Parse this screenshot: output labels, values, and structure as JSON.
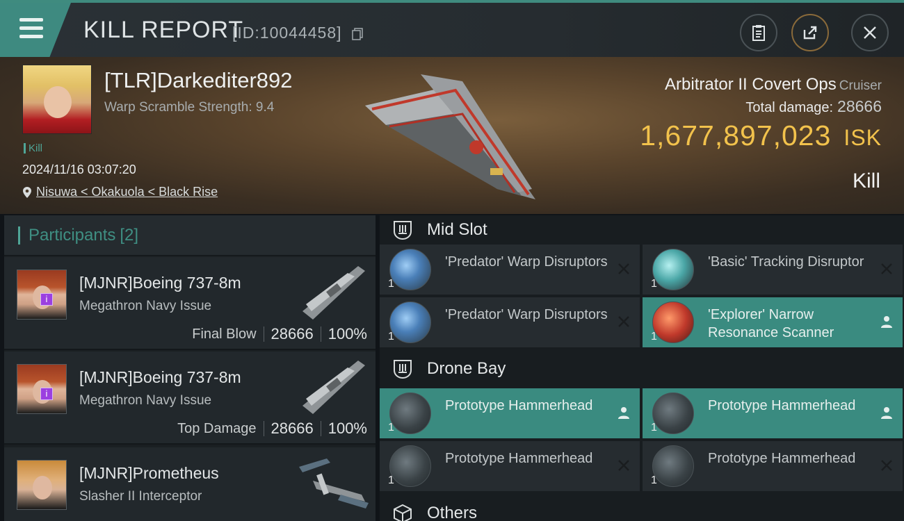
{
  "header": {
    "title": "KILL REPORT",
    "report_id": "[ID:10044458]"
  },
  "victim": {
    "name": "[TLR]Darkediter892",
    "warp_scramble": "Warp Scramble Strength: 9.4",
    "kill_tag": "Kill",
    "datetime": "2024/11/16 03:07:20",
    "location": "Nisuwa < Okakuola < Black Rise",
    "ship_name": "Arbitrator II Covert Ops",
    "ship_class": "Cruiser",
    "total_damage_label": "Total damage:",
    "total_damage": "28666",
    "isk_value": "1,677,897,023",
    "isk_unit": "ISK",
    "result": "Kill"
  },
  "participants": {
    "label": "Participants",
    "count": "[2]",
    "rows": [
      {
        "name": "[MJNR]Boeing 737-8m",
        "ship": "Megathron Navy Issue",
        "role": "Final Blow",
        "damage": "28666",
        "percent": "100%"
      },
      {
        "name": "[MJNR]Boeing 737-8m",
        "ship": "Megathron Navy Issue",
        "role": "Top Damage",
        "damage": "28666",
        "percent": "100%"
      },
      {
        "name": "[MJNR]Prometheus",
        "ship": "Slasher II Interceptor",
        "role": "",
        "damage": "",
        "percent": ""
      }
    ]
  },
  "mid_slot": {
    "title": "Mid Slot",
    "items": [
      {
        "qty": "1",
        "name": "'Predator' Warp Disruptors",
        "state": "destroyed",
        "icon": "warp-disruptor-icon"
      },
      {
        "qty": "1",
        "name": "'Basic' Tracking Disruptor",
        "state": "destroyed",
        "icon": "tracking-disruptor-icon"
      },
      {
        "qty": "1",
        "name": "'Predator' Warp Disruptors",
        "state": "destroyed",
        "icon": "warp-disruptor-icon"
      },
      {
        "qty": "1",
        "name": "'Explorer' Narrow Resonance Scanner",
        "state": "dropped",
        "icon": "scanner-icon"
      }
    ]
  },
  "drone_bay": {
    "title": "Drone Bay",
    "items": [
      {
        "qty": "1",
        "name": "Prototype Hammerhead",
        "state": "dropped",
        "icon": "drone-icon"
      },
      {
        "qty": "1",
        "name": "Prototype Hammerhead",
        "state": "dropped",
        "icon": "drone-icon"
      },
      {
        "qty": "1",
        "name": "Prototype Hammerhead",
        "state": "destroyed",
        "icon": "drone-icon"
      },
      {
        "qty": "1",
        "name": "Prototype Hammerhead",
        "state": "destroyed",
        "icon": "drone-icon"
      }
    ]
  },
  "others": {
    "title": "Others"
  },
  "colors": {
    "accent": "#3f8b7f",
    "isk": "#f2c24c",
    "dropped_bg": "#3a8b80",
    "destroyed_bg": "#262c30"
  }
}
